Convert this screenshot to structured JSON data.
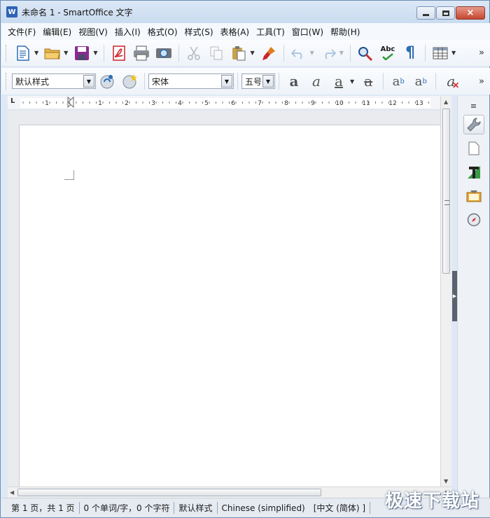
{
  "window": {
    "app_icon_letter": "W",
    "title": "未命名 1 - SmartOffice 文字"
  },
  "menu": [
    {
      "id": "file",
      "label": "文件(F)"
    },
    {
      "id": "edit",
      "label": "编辑(E)"
    },
    {
      "id": "view",
      "label": "视图(V)"
    },
    {
      "id": "insert",
      "label": "插入(I)"
    },
    {
      "id": "format",
      "label": "格式(O)"
    },
    {
      "id": "styles",
      "label": "样式(S)"
    },
    {
      "id": "table",
      "label": "表格(A)"
    },
    {
      "id": "tools",
      "label": "工具(T)"
    },
    {
      "id": "window",
      "label": "窗口(W)"
    },
    {
      "id": "help",
      "label": "帮助(H)"
    }
  ],
  "toolbar_standard": {
    "icons": [
      "new-document-icon",
      "open-folder-icon",
      "save-disk-icon",
      "export-pdf-icon",
      "print-icon",
      "print-preview-icon",
      "cut-icon",
      "copy-icon",
      "paste-icon",
      "format-paintbrush-icon",
      "undo-icon",
      "redo-icon",
      "find-replace-icon",
      "spellcheck-icon",
      "pilcrow-icon",
      "insert-table-icon"
    ],
    "spellcheck_text": "Abc",
    "pilcrow_glyph": "¶",
    "more_glyph": "»"
  },
  "toolbar_format": {
    "paragraph_style": "默认样式",
    "font_name": "宋体",
    "font_size": "五号",
    "more_glyph": "»"
  },
  "ruler": {
    "labels": [
      "1",
      "1",
      "2",
      "3",
      "4",
      "5",
      "6",
      "7",
      "8",
      "9",
      "10",
      "11",
      "12",
      "13"
    ],
    "tab_marker": "L"
  },
  "statusbar": {
    "page": "第 1 页，共 1 页",
    "word_count": "0 个单词/字，0 个字符",
    "style": "默认样式",
    "language": "Chinese (simplified)",
    "input_lang": "[中文 (简体) ]"
  },
  "watermark": "极速下载站",
  "colors": {
    "title_bar": "#c9dbef",
    "page_bg": "#ffffff",
    "workspace_bg": "#e9ebee",
    "sidebar_handle": "#59626e"
  }
}
